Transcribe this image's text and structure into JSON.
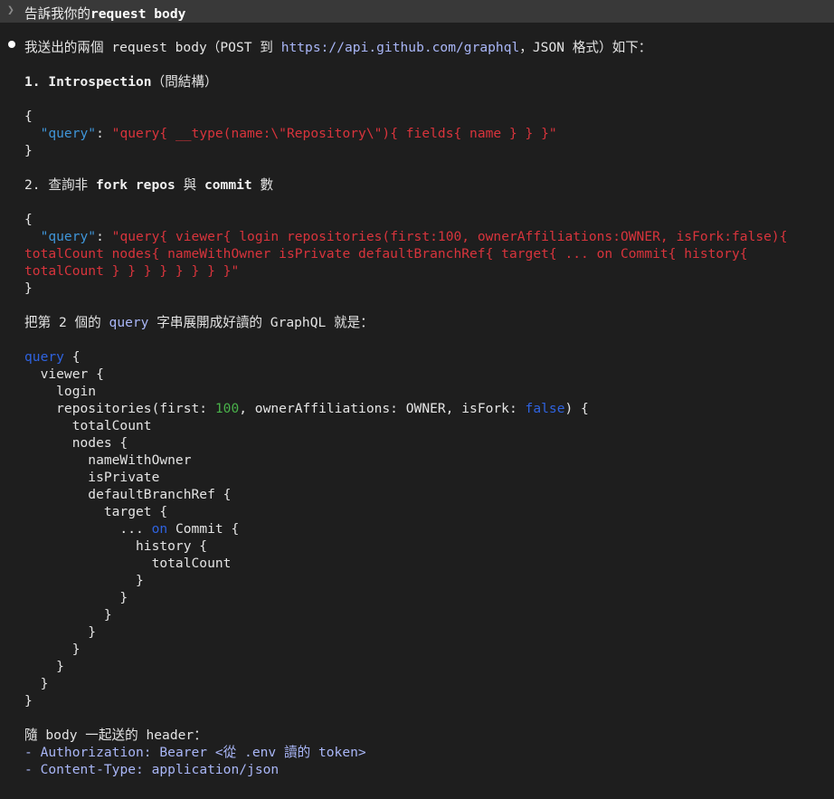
{
  "prompt": {
    "prefix": "告訴我你的",
    "bold": "request body"
  },
  "reply": {
    "intro_a": "我送出的兩個 request body（POST 到 ",
    "intro_url": "https://api.github.com/graphql",
    "intro_b": "，JSON 格式）如下：",
    "s1_title": "1. Introspection",
    "s1_suffix": "（問結構）",
    "brace_open": "{",
    "brace_close": "}",
    "key_query": "\"query\"",
    "colon": ": ",
    "s1_value": "\"query{ __type(name:\\\"Repository\\\"){ fields{ name } } }\"",
    "s2_prefix": "2. 查詢非 ",
    "s2_bold1": "fork repos",
    "s2_mid": " 與 ",
    "s2_bold2": "commit",
    "s2_suffix": " 數",
    "s2_value_l1": "\"query{ viewer{ login repositories(first:100, ownerAffiliations:OWNER, isFork:false){",
    "s2_value_l2": "totalCount nodes{ nameWithOwner isPrivate defaultBranchRef{ target{ ... on Commit{ history{",
    "s2_value_l3": "totalCount } } } } } } } }\"",
    "expand_a": "把第 2 個的 ",
    "expand_code": "query",
    "expand_b": " 字串展開成好讀的 GraphQL 就是：",
    "gql": {
      "l1_kw": "query",
      "l1_rest": " {",
      "l2": "  viewer {",
      "l3": "    login",
      "l4_a": "    repositories(first: ",
      "l4_num": "100",
      "l4_b": ", ownerAffiliations: OWNER, isFork: ",
      "l4_bool": "false",
      "l4_c": ") {",
      "l5": "      totalCount",
      "l6": "      nodes {",
      "l7": "        nameWithOwner",
      "l8": "        isPrivate",
      "l9": "        defaultBranchRef {",
      "l10": "          target {",
      "l11_a": "            ... ",
      "l11_kw": "on",
      "l11_b": " Commit {",
      "l12": "              history {",
      "l13": "                totalCount",
      "l14": "              }",
      "l15": "            }",
      "l16": "          }",
      "l17": "        }",
      "l18": "      }",
      "l19": "    }",
      "l20": "  }",
      "l21": "}"
    },
    "header_intro": "隨 body 一起送的 header：",
    "h1_dash": "- ",
    "h1_key": "Authorization:",
    "h1_val": " Bearer <從 .env 讀的 token>",
    "h2_dash": "- ",
    "h2_key": "Content-Type:",
    "h2_val": " application/json"
  },
  "colors": {
    "background": "#1e1e1e",
    "prompt_bar": "#393939",
    "string_red": "#d8343c",
    "key_blue": "#3f95d8",
    "link_lavender": "#a9b6f7",
    "keyword_blue": "#2f63e0",
    "number_green": "#49b14a"
  }
}
